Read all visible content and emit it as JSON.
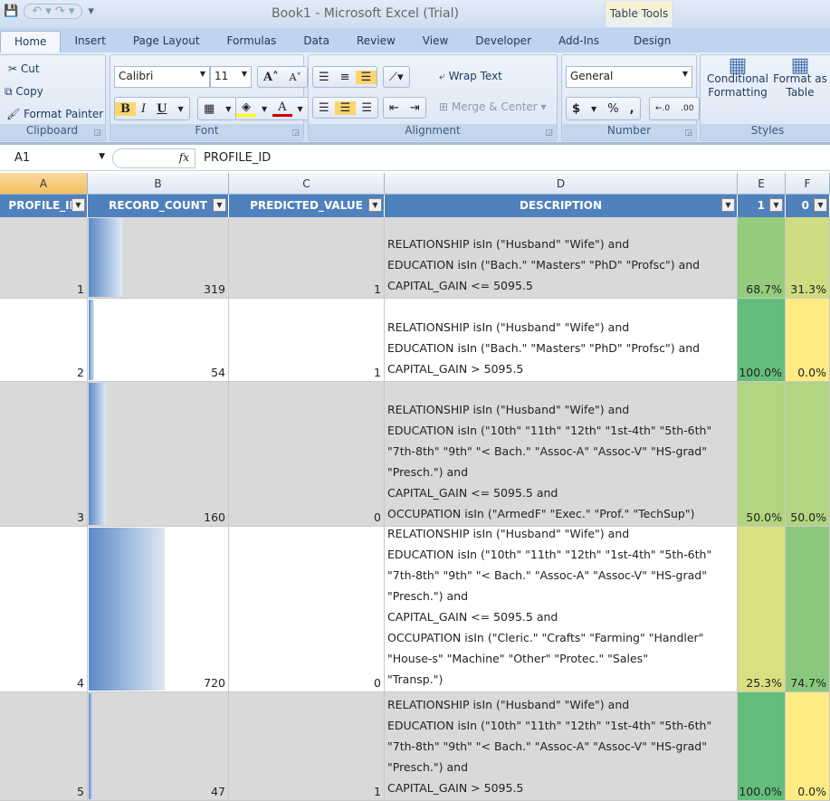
{
  "window": {
    "title": "Book1 - Microsoft Excel (Trial)",
    "context_tab": "Table Tools"
  },
  "tabs": [
    "Home",
    "Insert",
    "Page Layout",
    "Formulas",
    "Data",
    "Review",
    "View",
    "Developer",
    "Add-Ins",
    "Design"
  ],
  "ribbon": {
    "clipboard": {
      "label": "Clipboard",
      "cut": "Cut",
      "copy": "Copy",
      "format_painter": "Format Painter"
    },
    "font": {
      "label": "Font",
      "name": "Calibri",
      "size": "11",
      "bold": "B",
      "italic": "I",
      "underline": "U"
    },
    "alignment": {
      "label": "Alignment",
      "wrap": "Wrap Text",
      "merge": "Merge & Center"
    },
    "number": {
      "label": "Number",
      "format": "General",
      "currency": "$",
      "percent": "%",
      "comma": ","
    },
    "styles": {
      "label": "Styles",
      "conditional": "Conditional Formatting",
      "format_table": "Format as Table"
    }
  },
  "formula_bar": {
    "name_box": "A1",
    "fx": "fx",
    "value": "PROFILE_ID"
  },
  "columns": [
    "A",
    "B",
    "C",
    "D",
    "E",
    "F"
  ],
  "headers": [
    "PROFILE_ID",
    "RECORD_COUNT",
    "PREDICTED_VALUE",
    "DESCRIPTION",
    "1",
    "0"
  ],
  "rows": [
    {
      "id": "1",
      "count": "319",
      "count_value": 319,
      "pred": "1",
      "desc": [
        "RELATIONSHIP isIn (\"Husband\" \"Wife\") and",
        "EDUCATION isIn (\"Bach.\" \"Masters\" \"PhD\" \"Profsc\") and",
        "CAPITAL_GAIN <= 5095.5"
      ],
      "p1": "68.7%",
      "p0": "31.3%",
      "p1_value": 68.7,
      "p0_value": 31.3,
      "shade": true
    },
    {
      "id": "2",
      "count": "54",
      "count_value": 54,
      "pred": "1",
      "desc": [
        "RELATIONSHIP isIn (\"Husband\" \"Wife\") and",
        "EDUCATION isIn (\"Bach.\" \"Masters\" \"PhD\" \"Profsc\") and",
        "CAPITAL_GAIN > 5095.5"
      ],
      "p1": "100.0%",
      "p0": "0.0%",
      "p1_value": 100,
      "p0_value": 0,
      "shade": false
    },
    {
      "id": "3",
      "count": "160",
      "count_value": 160,
      "pred": "0",
      "desc": [
        "RELATIONSHIP isIn (\"Husband\" \"Wife\") and",
        "EDUCATION isIn (\"10th\" \"11th\" \"12th\" \"1st-4th\" \"5th-6th\"",
        "\"7th-8th\" \"9th\" \"< Bach.\" \"Assoc-A\" \"Assoc-V\" \"HS-grad\"",
        "\"Presch.\") and",
        "CAPITAL_GAIN <= 5095.5 and",
        "OCCUPATION isIn (\"ArmedF\" \"Exec.\" \"Prof.\" \"TechSup\")"
      ],
      "p1": "50.0%",
      "p0": "50.0%",
      "p1_value": 50,
      "p0_value": 50,
      "shade": true
    },
    {
      "id": "4",
      "count": "720",
      "count_value": 720,
      "pred": "0",
      "desc": [
        "RELATIONSHIP isIn (\"Husband\" \"Wife\") and",
        "EDUCATION isIn (\"10th\" \"11th\" \"12th\" \"1st-4th\" \"5th-6th\"",
        "\"7th-8th\" \"9th\" \"< Bach.\" \"Assoc-A\" \"Assoc-V\" \"HS-grad\"",
        "\"Presch.\") and",
        "CAPITAL_GAIN <= 5095.5 and",
        "OCCUPATION isIn (\"Cleric.\" \"Crafts\" \"Farming\" \"Handler\"",
        "\"House-s\" \"Machine\" \"Other\" \"Protec.\" \"Sales\"",
        "\"Transp.\")"
      ],
      "p1": "25.3%",
      "p0": "74.7%",
      "p1_value": 25.3,
      "p0_value": 74.7,
      "shade": false
    },
    {
      "id": "5",
      "count": "47",
      "count_value": 47,
      "pred": "1",
      "desc": [
        "RELATIONSHIP isIn (\"Husband\" \"Wife\") and",
        "EDUCATION isIn (\"10th\" \"11th\" \"12th\" \"1st-4th\" \"5th-6th\"",
        "\"7th-8th\" \"9th\" \"< Bach.\" \"Assoc-A\" \"Assoc-V\" \"HS-grad\"",
        "\"Presch.\") and",
        "CAPITAL_GAIN > 5095.5"
      ],
      "p1": "100.0%",
      "p0": "0.0%",
      "p1_value": 100,
      "p0_value": 0,
      "shade": true
    }
  ],
  "colors": {
    "header": "#4f81bd",
    "shade": "#d9d9d9",
    "green": "#63be7b",
    "yellow": "#ffeb84"
  }
}
